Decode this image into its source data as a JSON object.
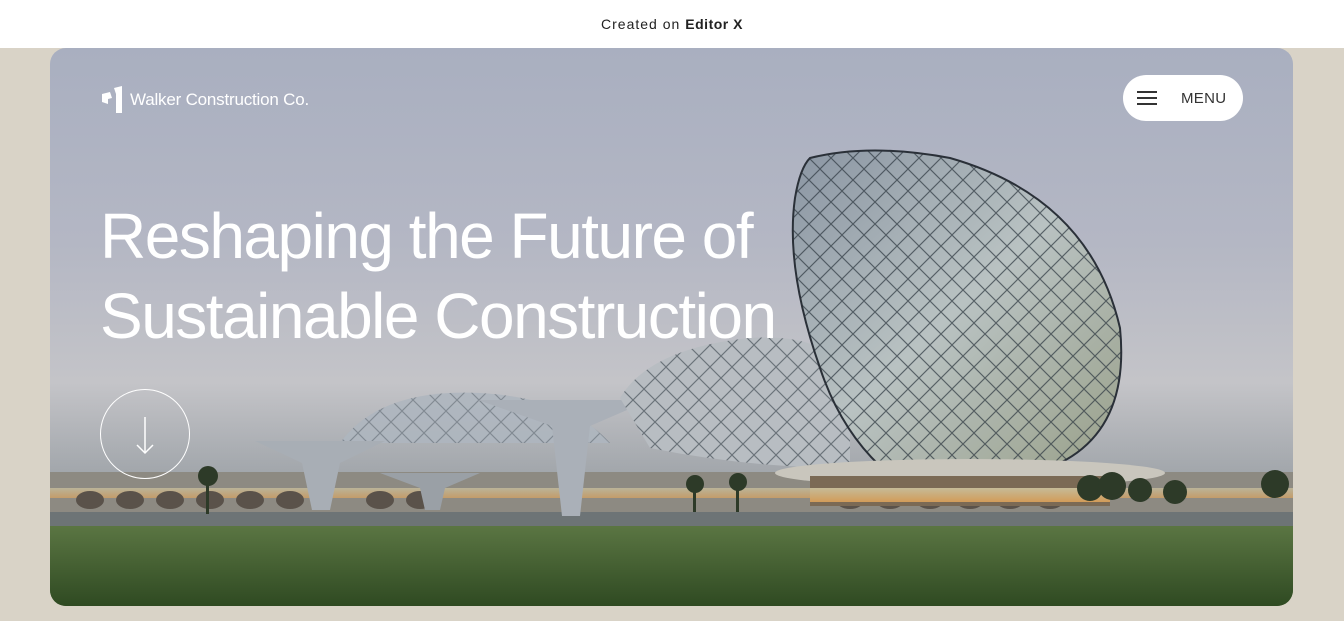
{
  "banner": {
    "prefix": "Created on",
    "brand": "Editor X"
  },
  "header": {
    "logo_text": "Walker Construction Co.",
    "logo_icon": "walker-logo-icon",
    "menu_label": "MENU",
    "menu_icon": "hamburger-icon"
  },
  "hero": {
    "headline_line1": "Reshaping the Future of",
    "headline_line2": "Sustainable Construction",
    "scroll_icon": "arrow-down-icon"
  },
  "colors": {
    "page_background": "#d9d3c7",
    "banner_background": "#ffffff",
    "hero_text": "#ffffff",
    "menu_background": "#ffffff"
  }
}
